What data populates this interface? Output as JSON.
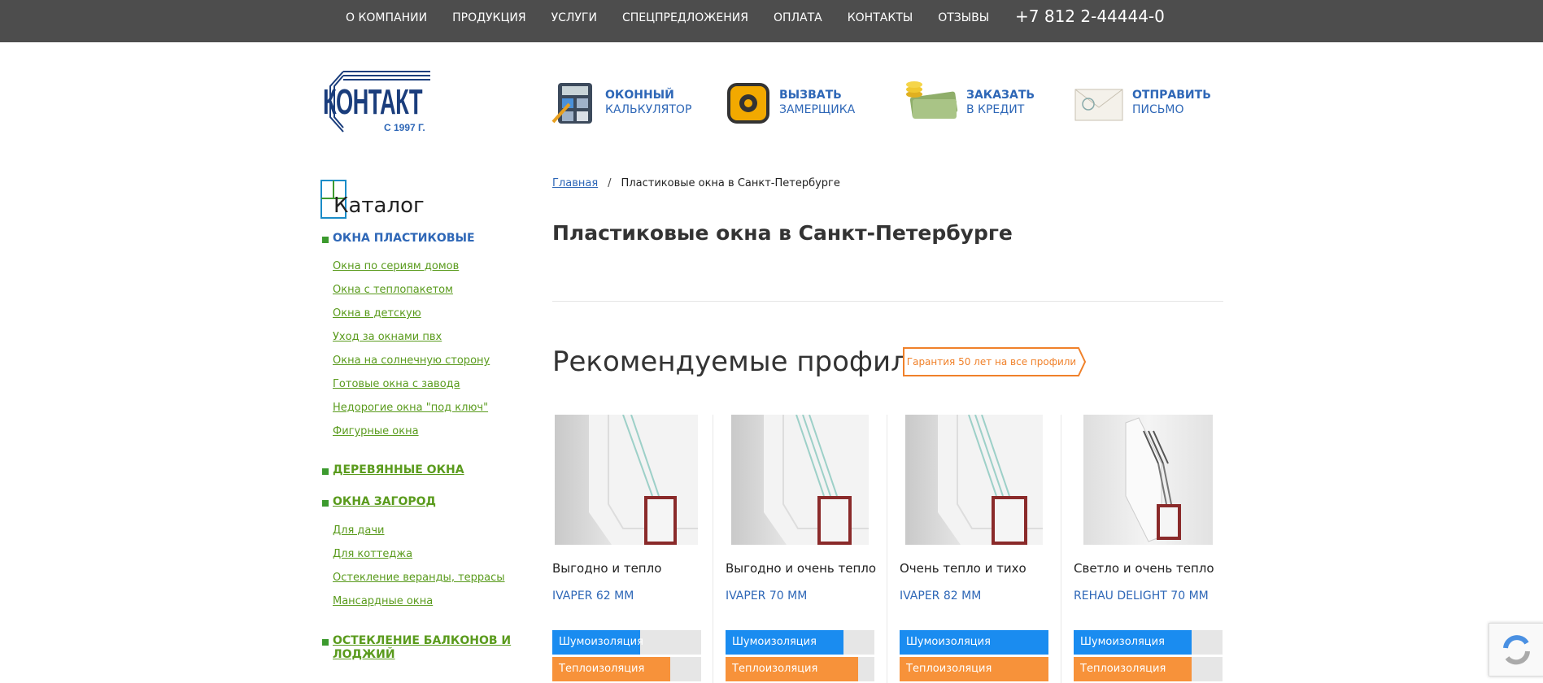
{
  "topnav": {
    "items": [
      "О КОМПАНИИ",
      "ПРОДУКЦИЯ",
      "УСЛУГИ",
      "СПЕЦПРЕДЛОЖЕНИЯ",
      "ОПЛАТА",
      "КОНТАКТЫ",
      "ОТЗЫВЫ"
    ],
    "phone": "+7 812 2-44444-0"
  },
  "logo": {
    "text": "КОНТАКТ",
    "year": "С 1997 Г."
  },
  "header_actions": [
    {
      "line1": "ОКОННЫЙ",
      "line2": "КАЛЬКУЛЯТОР",
      "icon": "calculator-icon"
    },
    {
      "line1": "ВЫЗВАТЬ",
      "line2": "ЗАМЕРЩИКА",
      "icon": "tape-measure-icon"
    },
    {
      "line1": "ЗАКАЗАТЬ",
      "line2": "В КРЕДИТ",
      "icon": "money-icon"
    },
    {
      "line1": "ОТПРАВИТЬ",
      "line2": "ПИСЬМО",
      "icon": "envelope-icon"
    }
  ],
  "catalog": {
    "title": "Каталог",
    "sections": [
      {
        "label": "ОКНА ПЛАСТИКОВЫЕ",
        "links": [
          "Окна по сериям домов",
          "Окна с теплопакетом",
          "Окна в детскую",
          "Уход за окнами пвх",
          "Окна на солнечную сторону",
          "Готовые окна с завода",
          "Недорогие окна \"под ключ\"",
          "Фигурные окна"
        ]
      },
      {
        "label": "ДЕРЕВЯННЫЕ ОКНА",
        "links": []
      },
      {
        "label": "ОКНА ЗАГОРОД",
        "links": [
          "Для дачи",
          "Для коттеджа",
          "Остекление веранды, террасы",
          "Мансардные окна"
        ]
      },
      {
        "label": "ОСТЕКЛЕНИЕ БАЛКОНОВ И",
        "label2": "ЛОДЖИЙ",
        "links": []
      }
    ]
  },
  "breadcrumb": {
    "home": "Главная",
    "sep": "/",
    "current": "Пластиковые окна в Санкт-Петербурге"
  },
  "page_title": "Пластиковые окна в Санкт-Петербурге",
  "section_title": "Рекомендуемые профили",
  "badge": "Гарантия 50 лет на все профили",
  "bar_labels": {
    "noise": "Шумоизоляция",
    "heat": "Теплоизоляция"
  },
  "colors": {
    "noise": "#1a8cf0",
    "heat": "#f7923a"
  },
  "products": [
    {
      "name": "Выгодно и тепло",
      "profile": "IVAPER 62 ММ",
      "noise": 0.59,
      "heat": 0.79
    },
    {
      "name": "Выгодно и очень тепло",
      "profile": "IVAPER 70 ММ",
      "noise": 0.79,
      "heat": 0.89
    },
    {
      "name": "Очень тепло и тихо",
      "profile": "IVAPER 82 ММ",
      "noise": 1.0,
      "heat": 1.0
    },
    {
      "name": "Светло и очень тепло",
      "profile": "REHAU DELIGHT 70 ММ",
      "noise": 0.79,
      "heat": 0.79
    }
  ]
}
